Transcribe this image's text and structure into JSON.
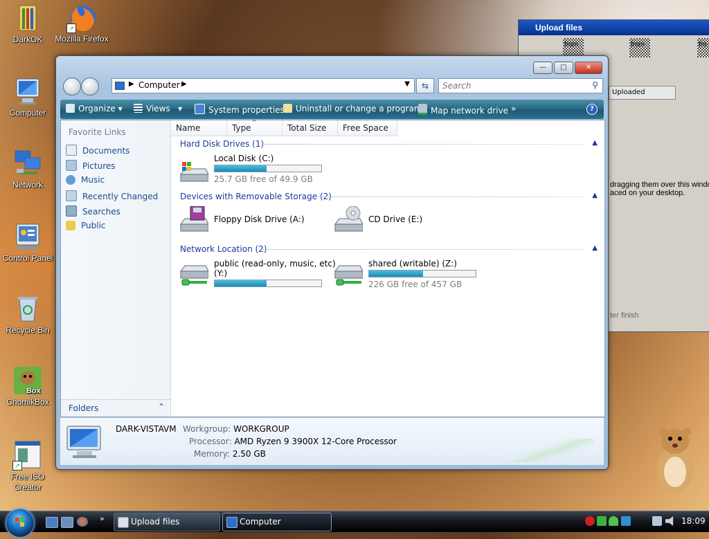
{
  "desktop": {
    "icons": [
      {
        "label": "DarkOK"
      },
      {
        "label": "Mozilla Firefox"
      },
      {
        "label": "Computer"
      },
      {
        "label": "Network"
      },
      {
        "label": "Control Panel"
      },
      {
        "label": "Recycle Bin"
      },
      {
        "label": "ChomikBox"
      },
      {
        "label": "Free ISO Creator"
      }
    ]
  },
  "upload_window": {
    "title": "Upload files",
    "tab_label": "Uploaded",
    "text_line1": "dragging them over this windo",
    "text_line2": "aced on your desktop.",
    "text_line3": "ter finish",
    "checker_labels": [
      "from",
      "from",
      "fro"
    ]
  },
  "explorer": {
    "address": {
      "path": "Computer"
    },
    "search": {
      "placeholder": "Search"
    },
    "window_buttons": {
      "minimize": "—",
      "maximize": "□",
      "close": "✕"
    },
    "toolbar": {
      "organize": "Organize",
      "views": "Views",
      "system_properties": "System properties",
      "uninstall": "Uninstall or change a program",
      "map_drive": "Map network drive",
      "more": "»",
      "help": "?"
    },
    "sidebar": {
      "header": "Favorite Links",
      "items": [
        {
          "label": "Documents"
        },
        {
          "label": "Pictures"
        },
        {
          "label": "Music"
        },
        {
          "label": "Recently Changed"
        },
        {
          "label": "Searches"
        },
        {
          "label": "Public"
        }
      ],
      "folders": "Folders"
    },
    "columns": [
      "Name",
      "Type",
      "Total Size",
      "Free Space"
    ],
    "groups": {
      "hdd": {
        "title": "Hard Disk Drives (1)",
        "drives": [
          {
            "name": "Local Disk (C:)",
            "free_text": "25.7 GB free of 49.9 GB",
            "used_fraction": 0.485
          }
        ]
      },
      "removable": {
        "title": "Devices with Removable Storage (2)",
        "drives": [
          {
            "name": "Floppy Disk Drive (A:)"
          },
          {
            "name": "CD Drive (E:)"
          }
        ]
      },
      "network": {
        "title": "Network Location (2)",
        "drives": [
          {
            "name_line1": "public (read-only, music, etc)",
            "name_line2": "(Y:)",
            "used_fraction": 0.49
          },
          {
            "name": "shared (writable) (Z:)",
            "free_text": "226 GB free of 457 GB",
            "used_fraction": 0.505
          }
        ]
      }
    },
    "details": {
      "computer_name": "DARK-VISTAVM",
      "workgroup_label": "Workgroup:",
      "workgroup": "WORKGROUP",
      "processor_label": "Processor:",
      "processor": "AMD Ryzen 9 3900X 12-Core Processor",
      "memory_label": "Memory:",
      "memory": "2.50 GB"
    }
  },
  "taskbar": {
    "buttons": [
      {
        "label": "Upload files"
      },
      {
        "label": "Computer"
      }
    ],
    "quick_launch_more": "»",
    "clock": "18:09"
  },
  "colors": {
    "toolbar": "#2a6a84",
    "link": "#1a4a90",
    "group_header": "#1a3a9a",
    "progress_fill": "#1a8ab4"
  }
}
